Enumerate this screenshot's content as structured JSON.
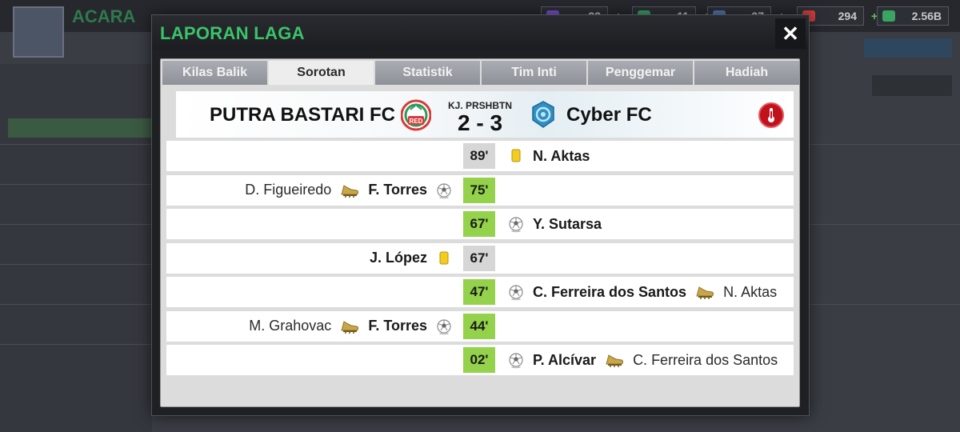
{
  "background": {
    "title": "ACARA",
    "resources": [
      {
        "name": "tokens",
        "value": "33",
        "color": "#7b4fd1"
      },
      {
        "name": "cash-notes",
        "value": "11",
        "color": "#3aa463"
      },
      {
        "name": "energy",
        "value": "27",
        "color": "#4f79b8"
      },
      {
        "name": "medical",
        "value": "294",
        "color": "#d23b3b"
      },
      {
        "name": "money",
        "value": "2.56B",
        "color": "#3aa463"
      }
    ]
  },
  "modal": {
    "title": "LAPORAN LAGA",
    "close_label": "✕",
    "tabs": [
      {
        "label": "Kilas Balik",
        "active": false
      },
      {
        "label": "Sorotan",
        "active": true
      },
      {
        "label": "Statistik",
        "active": false
      },
      {
        "label": "Tim Inti",
        "active": false
      },
      {
        "label": "Penggemar",
        "active": false
      },
      {
        "label": "Hadiah",
        "active": false
      }
    ],
    "match": {
      "home_team": "PUTRA BASTARI FC",
      "away_team": "Cyber FC",
      "stadium": "KJ. PRSHBTN",
      "score": "2 - 3",
      "home_crest_text": "RED",
      "home_color": "#d83b3b",
      "away_color": "#2f8fc2"
    },
    "events": [
      {
        "minute": "89'",
        "type": "card",
        "side": "away",
        "player": "N. Aktas",
        "assist": ""
      },
      {
        "minute": "75'",
        "type": "goal",
        "side": "home",
        "player": "F. Torres",
        "assist": "D. Figueiredo"
      },
      {
        "minute": "67'",
        "type": "goal",
        "side": "away",
        "player": "Y. Sutarsa",
        "assist": ""
      },
      {
        "minute": "67'",
        "type": "card",
        "side": "home",
        "player": "J. López",
        "assist": ""
      },
      {
        "minute": "47'",
        "type": "goal",
        "side": "away",
        "player": "C. Ferreira dos Santos",
        "assist": "N. Aktas"
      },
      {
        "minute": "44'",
        "type": "goal",
        "side": "home",
        "player": "F. Torres",
        "assist": "M. Grahovac"
      },
      {
        "minute": "02'",
        "type": "goal",
        "side": "away",
        "player": "P. Alcívar",
        "assist": "C. Ferreira dos Santos"
      }
    ],
    "icons": {
      "goal": "soccer-ball-icon",
      "assist": "boot-icon",
      "card": "yellow-card-icon"
    },
    "colors": {
      "accent_green": "#39c46a",
      "goal_minute_bg": "#93d24a",
      "card_minute_bg": "#d6d6d6",
      "yellow_card": "#f2cc1f"
    }
  }
}
